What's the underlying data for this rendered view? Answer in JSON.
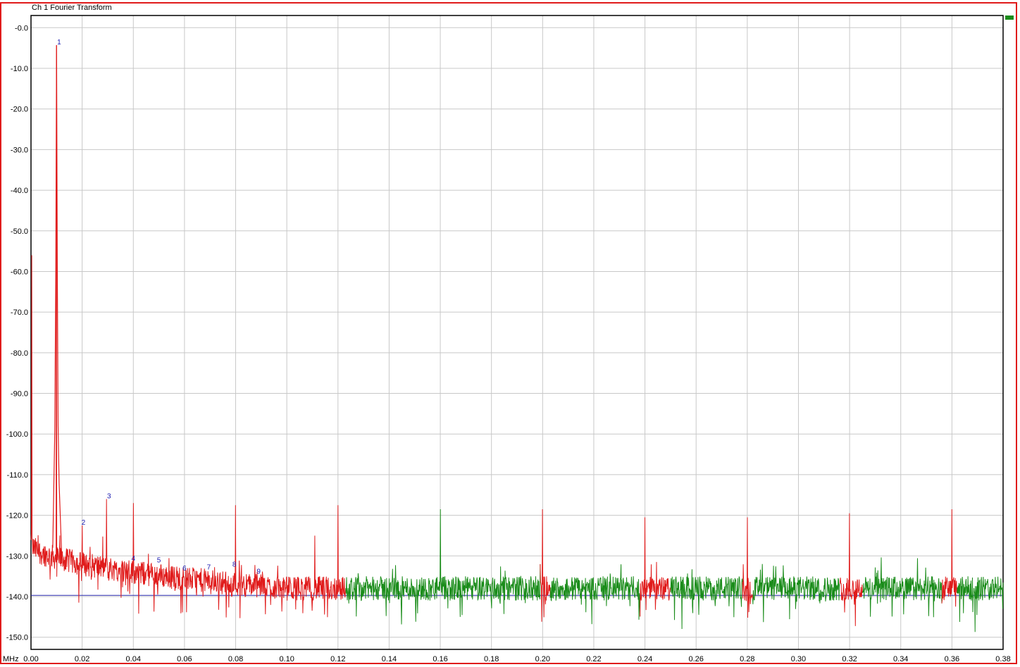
{
  "window": {
    "title": "Ch 1 Fourier Transform"
  },
  "colors": {
    "background": "#ffffff",
    "grid": "#c8c8c8",
    "trace_primary": "#e01b1b",
    "trace_secondary": "#1a8c1a",
    "reference_line": "#2a2ab0",
    "marker_text": "#1a1ab0",
    "frame": "#e01b1b"
  },
  "chart_data": {
    "type": "line",
    "title": "Ch 1 Fourier Transform",
    "x_unit": "MHz",
    "xlabel": "",
    "ylabel": "",
    "xlim": [
      0.0,
      0.38
    ],
    "ylim": [
      -153,
      3
    ],
    "x_ticks": [
      "0.00",
      "0.02",
      "0.04",
      "0.06",
      "0.08",
      "0.10",
      "0.12",
      "0.14",
      "0.16",
      "0.18",
      "0.20",
      "0.22",
      "0.24",
      "0.26",
      "0.28",
      "0.30",
      "0.32",
      "0.34",
      "0.36",
      "0.38"
    ],
    "y_ticks": [
      "-0.0",
      "-10.0",
      "-20.0",
      "-30.0",
      "-40.0",
      "-50.0",
      "-60.0",
      "-70.0",
      "-80.0",
      "-90.0",
      "-100.0",
      "-110.0",
      "-120.0",
      "-130.0",
      "-140.0",
      "-150.0"
    ],
    "grid": true,
    "reference_level": -139.7,
    "noise_floor": {
      "start_level": -127,
      "end_level": -138,
      "settle_freq": 0.1,
      "primary_until": 0.123,
      "red_regions": [
        [
          0.199,
          0.203
        ],
        [
          0.238,
          0.25
        ],
        [
          0.278,
          0.282
        ],
        [
          0.316,
          0.325
        ],
        [
          0.356,
          0.362
        ]
      ]
    },
    "spectral_lines": [
      {
        "freq": 0.0003,
        "level": -56
      },
      {
        "freq": 0.01,
        "level": -4.3
      },
      {
        "freq": 0.02,
        "level": -122.5
      },
      {
        "freq": 0.0295,
        "level": -116
      },
      {
        "freq": 0.04,
        "level": -117
      },
      {
        "freq": 0.08,
        "level": -117.5
      },
      {
        "freq": 0.111,
        "level": -125
      },
      {
        "freq": 0.12,
        "level": -117.5
      },
      {
        "freq": 0.16,
        "level": -118.5
      },
      {
        "freq": 0.2,
        "level": -118.5
      },
      {
        "freq": 0.24,
        "level": -120.5
      },
      {
        "freq": 0.28,
        "level": -120.5
      },
      {
        "freq": 0.32,
        "level": -119.5
      },
      {
        "freq": 0.36,
        "level": -118.5
      }
    ],
    "harmonic_markers": [
      {
        "label": "1",
        "freq": 0.011,
        "level": -4.3
      },
      {
        "label": "2",
        "freq": 0.0205,
        "level": -122.5
      },
      {
        "label": "3",
        "freq": 0.0305,
        "level": -116
      },
      {
        "label": "4",
        "freq": 0.04,
        "level": -131.3
      },
      {
        "label": "5",
        "freq": 0.05,
        "level": -131.8
      },
      {
        "label": "6",
        "freq": 0.06,
        "level": -133.8
      },
      {
        "label": "7",
        "freq": 0.0695,
        "level": -133.5
      },
      {
        "label": "8",
        "freq": 0.0795,
        "level": -132.8
      },
      {
        "label": "9",
        "freq": 0.089,
        "level": -134.5
      }
    ]
  }
}
